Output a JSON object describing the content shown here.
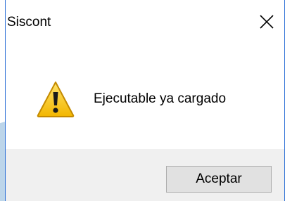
{
  "window": {
    "title": "Siscont",
    "close_icon": "close-icon"
  },
  "dialog": {
    "icon": "warning-icon",
    "message": "Ejecutable ya cargado"
  },
  "buttons": {
    "ok_label": "Aceptar"
  },
  "colors": {
    "window_border": "#2b6fd6",
    "content_bg": "#ffffff",
    "footer_bg": "#f0f0f0",
    "button_bg": "#e1e1e1",
    "button_border": "#adadad",
    "warning_fill": "#f5c400"
  }
}
